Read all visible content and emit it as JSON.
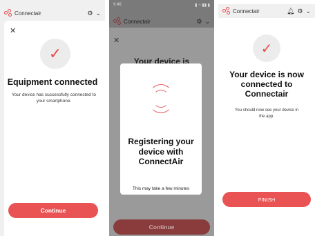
{
  "brand": "Connectair",
  "screen1": {
    "title": "Equipment connected",
    "subtitle": "Your device has successfully connected to your smartphone.",
    "button": "Continue"
  },
  "screen2": {
    "time": "9:46",
    "background_title": "Your device is",
    "modal_title": "Registering your device with ConnectAir",
    "modal_note": "This may take a few minutes",
    "button": "Continue"
  },
  "screen3": {
    "title": "Your device is now connected to Connectair",
    "subtitle": "You should now see your device in the app.",
    "button": "FINISH"
  },
  "colors": {
    "accent": "#ea5353",
    "check_bg": "#ececec"
  },
  "icons": [
    "logo-icon",
    "settings-icon",
    "chevron-down-icon",
    "bell-icon",
    "close-icon",
    "check-icon",
    "wifi-signal-icon"
  ]
}
